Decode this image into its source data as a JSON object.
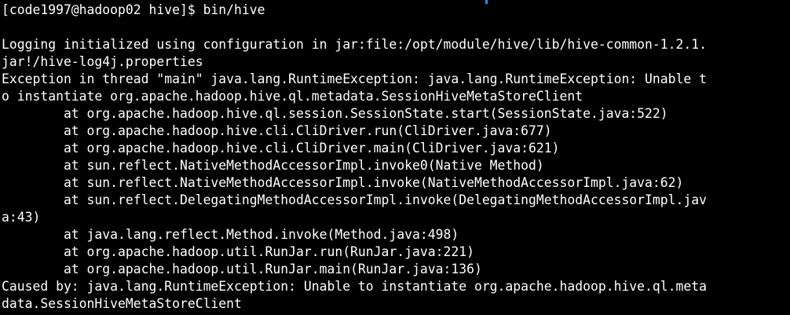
{
  "terminal": {
    "prompt": "[code1997@hadoop02 hive]$ bin/hive",
    "lines": [
      "",
      "Logging initialized using configuration in jar:file:/opt/module/hive/lib/hive-common-1.2.1.",
      "jar!/hive-log4j.properties",
      "Exception in thread \"main\" java.lang.RuntimeException: java.lang.RuntimeException: Unable t",
      "o instantiate org.apache.hadoop.hive.ql.metadata.SessionHiveMetaStoreClient",
      "        at org.apache.hadoop.hive.ql.session.SessionState.start(SessionState.java:522)",
      "        at org.apache.hadoop.hive.cli.CliDriver.run(CliDriver.java:677)",
      "        at org.apache.hadoop.hive.cli.CliDriver.main(CliDriver.java:621)",
      "        at sun.reflect.NativeMethodAccessorImpl.invoke0(Native Method)",
      "        at sun.reflect.NativeMethodAccessorImpl.invoke(NativeMethodAccessorImpl.java:62)",
      "        at sun.reflect.DelegatingMethodAccessorImpl.invoke(DelegatingMethodAccessorImpl.jav",
      "a:43)",
      "        at java.lang.reflect.Method.invoke(Method.java:498)",
      "        at org.apache.hadoop.util.RunJar.run(RunJar.java:221)",
      "        at org.apache.hadoop.util.RunJar.main(RunJar.java:136)",
      "Caused by: java.lang.RuntimeException: Unable to instantiate org.apache.hadoop.hive.ql.meta",
      "data.SessionHiveMetaStoreClient"
    ],
    "colors": {
      "background": "#000000",
      "foreground": "#ffffff",
      "marker": "#1e90ff"
    }
  }
}
